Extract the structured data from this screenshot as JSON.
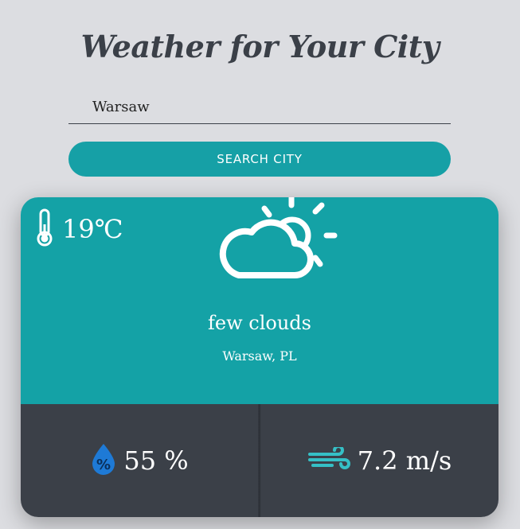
{
  "header": {
    "title": "Weather for Your City"
  },
  "search": {
    "value": "Warsaw",
    "button_label": "SEARCH CITY"
  },
  "weather": {
    "temperature": "19℃",
    "icon": "partly-cloudy-icon",
    "description": "few clouds",
    "location": "Warsaw, PL",
    "humidity": "55 %",
    "wind": "7.2 m/s"
  },
  "colors": {
    "background": "#dcdde1",
    "accent": "#16a0a6",
    "dark_panel": "#3b4048",
    "humidity_icon": "#1e7ad6",
    "wind_icon": "#35c0c6"
  }
}
